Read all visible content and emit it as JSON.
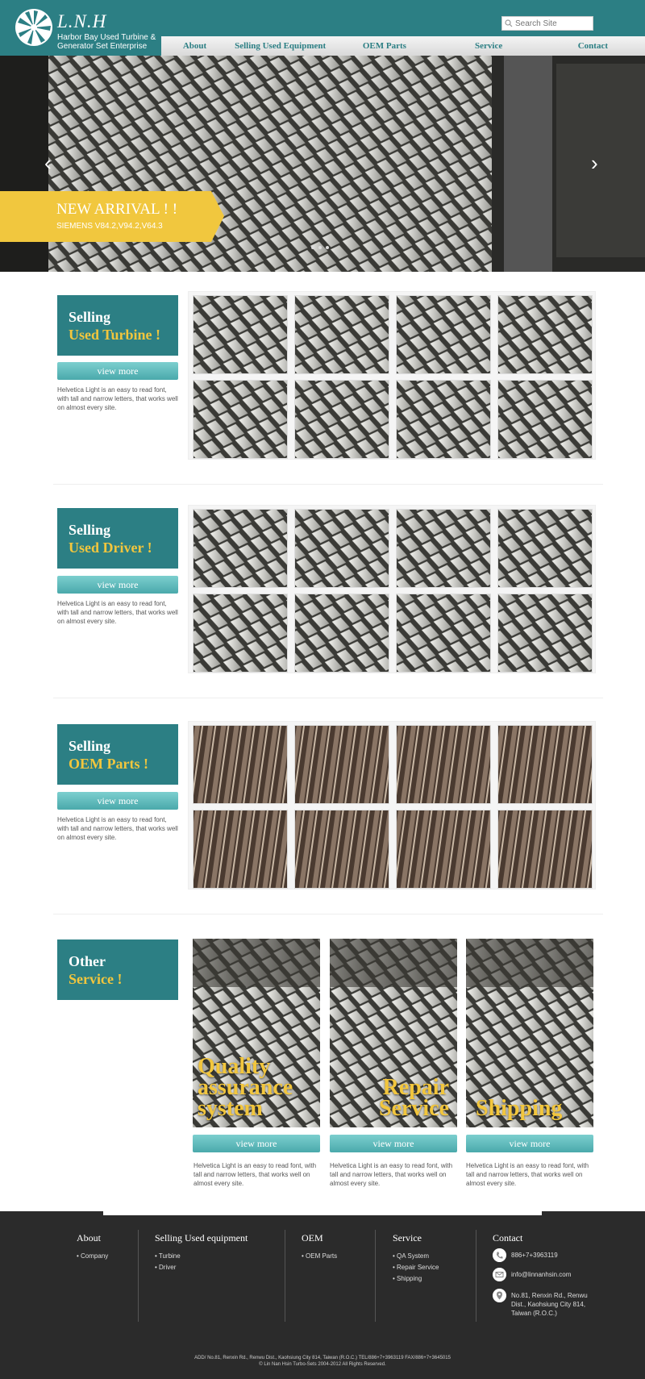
{
  "brand": {
    "logo_text": "L.N.H",
    "tagline": "Harbor Bay Used Turbine & Generator Set Enterprise",
    "accent": "#2c7f84",
    "highlight": "#f2c63d"
  },
  "search": {
    "placeholder": "Search Site"
  },
  "nav": [
    "About",
    "Selling Used Equipment",
    "OEM Parts",
    "Service",
    "Contact"
  ],
  "hero": {
    "title": "NEW ARRIVAL ! !",
    "subtitle": "SIEMENS V84.2,V94.2,V64.3"
  },
  "sections": [
    {
      "line1": "Selling",
      "line2": "Used Turbine !",
      "button": "view more",
      "desc": "Helvetica Light is an easy to read font, with tall and narrow letters, that works well on almost every site."
    },
    {
      "line1": "Selling",
      "line2": "Used Driver !",
      "button": "view more",
      "desc": "Helvetica Light is an easy to read font, with tall and narrow letters, that works well on almost every site."
    },
    {
      "line1": "Selling",
      "line2": "OEM Parts !",
      "button": "view more",
      "desc": "Helvetica Light is an easy to read font, with tall and narrow letters, that works well on almost every site."
    }
  ],
  "service": {
    "line1": "Other",
    "line2": "Service !",
    "cards": [
      {
        "caption": "Quality assurance system",
        "button": "view more",
        "desc": "Helvetica Light is an easy to read font, with tall and narrow letters, that works well on almost every site."
      },
      {
        "caption": "Repair Service",
        "button": "view more",
        "desc": "Helvetica Light is an easy to read font, with tall and narrow letters, that works well on almost every site."
      },
      {
        "caption": "Shipping",
        "button": "view more",
        "desc": "Helvetica Light is an easy to read font, with tall and narrow letters, that works well on almost every site."
      }
    ]
  },
  "footer": {
    "cols": [
      {
        "title": "About",
        "links": [
          "• Company"
        ]
      },
      {
        "title": "Selling Used equipment",
        "links": [
          "• Turbine",
          "• Driver"
        ]
      },
      {
        "title": "OEM",
        "links": [
          "• OEM Parts"
        ]
      },
      {
        "title": "Service",
        "links": [
          "• QA System",
          "• Repair Service",
          "• Shipping"
        ]
      }
    ],
    "contact": {
      "title": "Contact",
      "phone": "886+7+3963119",
      "email": "info@linnanhsin.com",
      "address": "No.81, Renxin Rd., Renwu Dist., Kaohsiung City 814, Taiwan (R.O.C.)"
    },
    "copy_line1": "ADD/ No.81, Renxin Rd., Renwu Dist., Kaohsiung City 814, Taiwan (R.O.C.) TEL/886+7+3963119 FAX/886+7+3645015",
    "copy_line2": "© Lin Nan Hsin Turbo-Sets 2004-2012 All Rights Reserved."
  }
}
